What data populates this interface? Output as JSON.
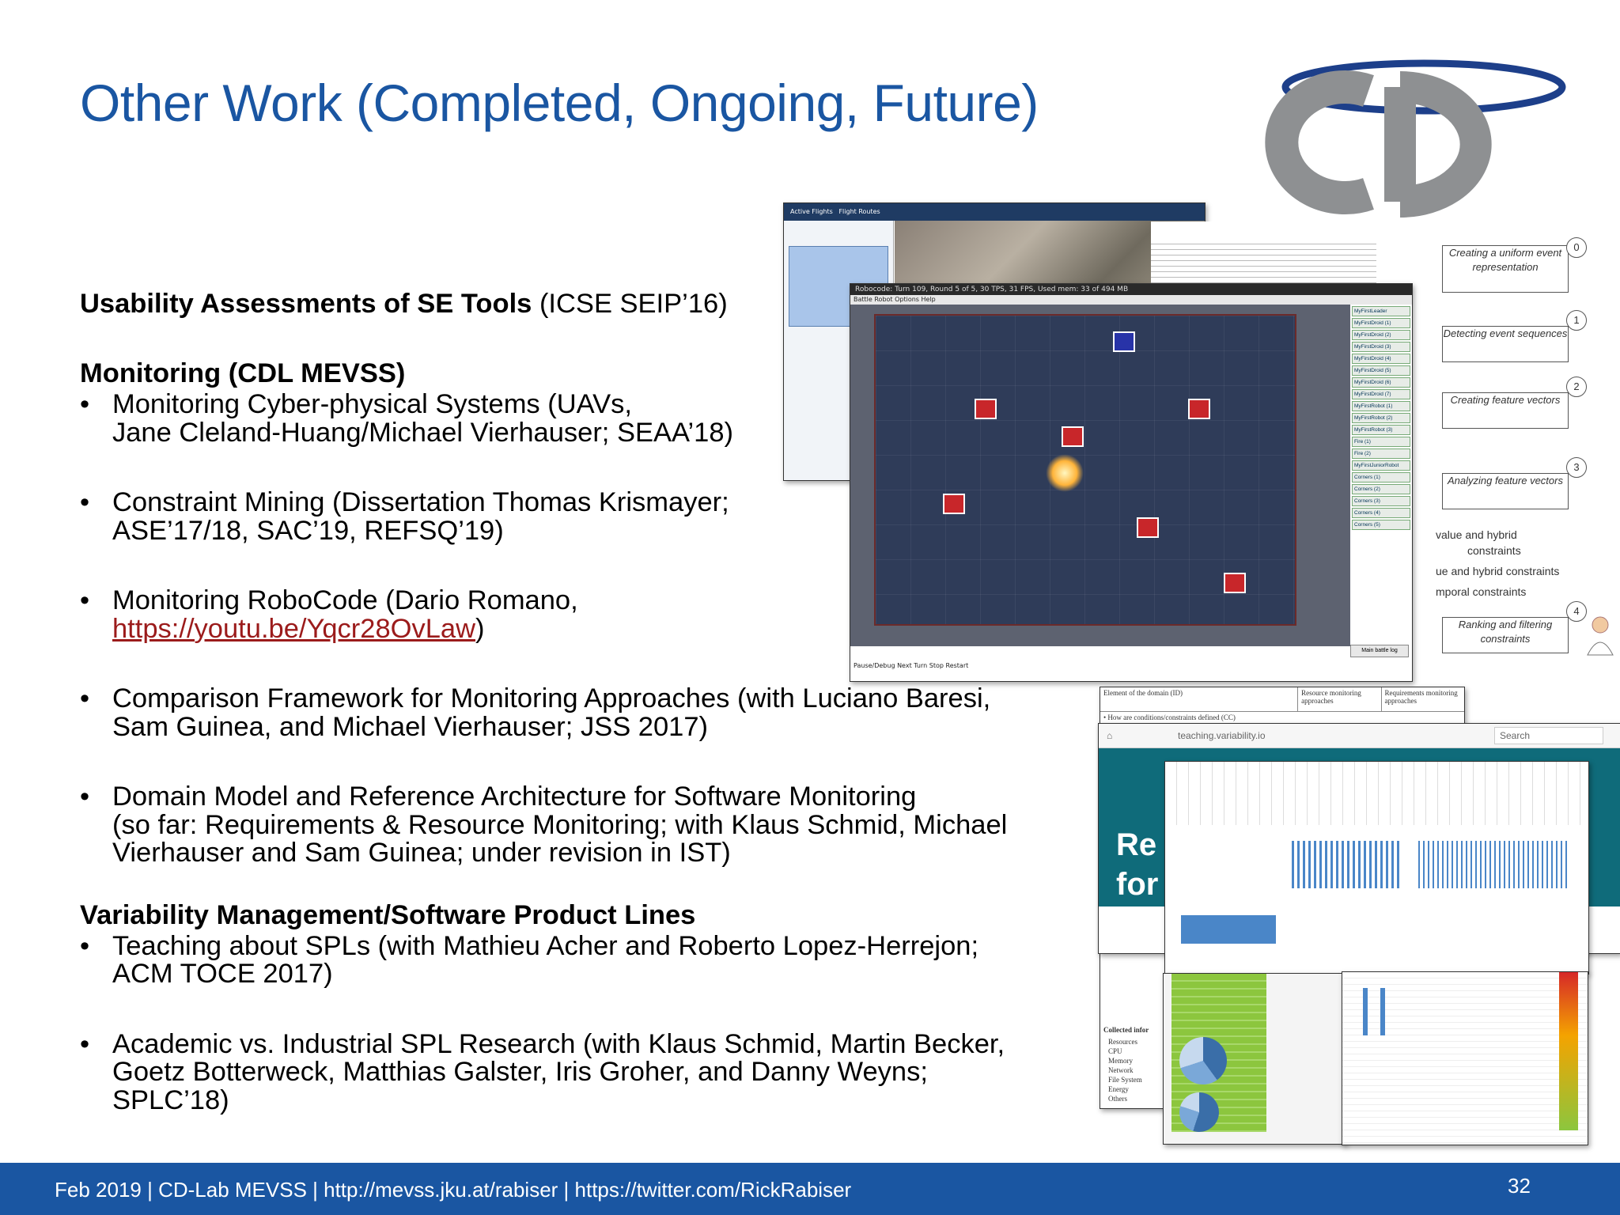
{
  "title": "Other Work (Completed, Ongoing, Future)",
  "sections": {
    "usability": {
      "heading": "Usability Assessments of SE Tools",
      "venue": "(ICSE SEIP’16)"
    },
    "monitoring": {
      "heading": "Monitoring (CDL MEVSS)",
      "bullets": [
        {
          "line1": "Monitoring Cyber-physical Systems (UAVs,",
          "line2": "Jane Cleland-Huang/Michael Vierhauser; SEAA’18)"
        },
        {
          "line1": "Constraint Mining (Dissertation Thomas Krismayer;",
          "line2": "ASE’17/18, SAC’19, REFSQ’19)"
        },
        {
          "line1": "Monitoring RoboCode (Dario Romano,",
          "link": "https://youtu.be/Yqcr28OvLaw",
          "after_link": ")"
        },
        {
          "line1": "Comparison Framework for Monitoring Approaches (with Luciano Baresi,",
          "line2": "Sam Guinea, and Michael Vierhauser; JSS 2017)"
        },
        {
          "line1": "Domain Model and Reference Architecture for Software Monitoring",
          "line2": "(so far: Requirements & Resource Monitoring; with Klaus Schmid, Michael",
          "line3": "Vierhauser and Sam Guinea; under revision in IST)"
        }
      ]
    },
    "variability": {
      "heading": "Variability Management/Software Product Lines",
      "bullets": [
        {
          "line1": "Teaching about SPLs (with Mathieu Acher and Roberto Lopez-Herrejon;",
          "line2": "ACM TOCE 2017)"
        },
        {
          "line1": "Academic vs. Industrial SPL Research (with Klaus Schmid, Martin Becker,",
          "line2": "Goetz Botterweck, Matthias Galster, Iris Groher, and Danny Weyns;",
          "line3": "SPLC’18)"
        }
      ]
    }
  },
  "bullet_glyph": "•",
  "collage": {
    "robocode": {
      "title": "Robocode: Turn 109, Round 5 of 5, 30 TPS, 31 FPS, Used mem: 33 of 494 MB",
      "menu": "Battle   Robot   Options   Help",
      "controls": "Pause/Debug   Next Turn   Stop   Restart",
      "battle_log": "Main battle log",
      "robots": [
        "MyFirstLeader",
        "MyFirstDroid (1)",
        "MyFirstDroid (2)",
        "MyFirstDroid (3)",
        "MyFirstDroid (4)",
        "MyFirstDroid (5)",
        "MyFirstDroid (6)",
        "MyFirstDroid (7)",
        "MyFirstRobot (1)",
        "MyFirstRobot (2)",
        "MyFirstRobot (3)",
        "Fire (1)",
        "Fire (2)",
        "MyFirstJuniorRobot",
        "Corners (1)",
        "Corners (2)",
        "Corners (3)",
        "Corners (4)",
        "Corners (5)"
      ]
    },
    "flight": {
      "tab1": "Active Flights",
      "tab2": "Flight Routes"
    },
    "flow": {
      "steps": [
        {
          "num": "0",
          "label": "Creating a uniform event representation"
        },
        {
          "num": "1",
          "label": "Detecting event sequences"
        },
        {
          "num": "2",
          "label": "Creating feature vectors"
        },
        {
          "num": "3",
          "label": "Analyzing feature vectors"
        },
        {
          "num": "4",
          "label": "Ranking and filtering constraints"
        }
      ],
      "notes": [
        "value and hybrid",
        "constraints",
        "ue and hybrid constraints",
        "mporal constraints"
      ]
    },
    "browser": {
      "url": "teaching.variability.io",
      "search": "Search",
      "banner1": "Re",
      "banner2": "for"
    },
    "domain_table": {
      "col1": "Element of the domain (ID)",
      "col2": "Resource monitoring approaches",
      "col3": "Requirements monitoring approaches",
      "row1": "• How are conditions/constraints defined (CC)",
      "collected": "Collected infor",
      "items": [
        "Resources",
        "CPU",
        "Memory",
        "Network",
        "File System",
        "Energy",
        "Others"
      ]
    }
  },
  "footer": {
    "text": "Feb 2019 |  CD-Lab MEVSS | http://mevss.jku.at/rabiser | https://twitter.com/RickRabiser",
    "page": "32"
  },
  "colors": {
    "title": "#1a56a2",
    "footer_bg": "#1a56a2",
    "link": "#9b1b1b",
    "logo_gray": "#8e9092",
    "logo_blue": "#1d3f8a"
  }
}
